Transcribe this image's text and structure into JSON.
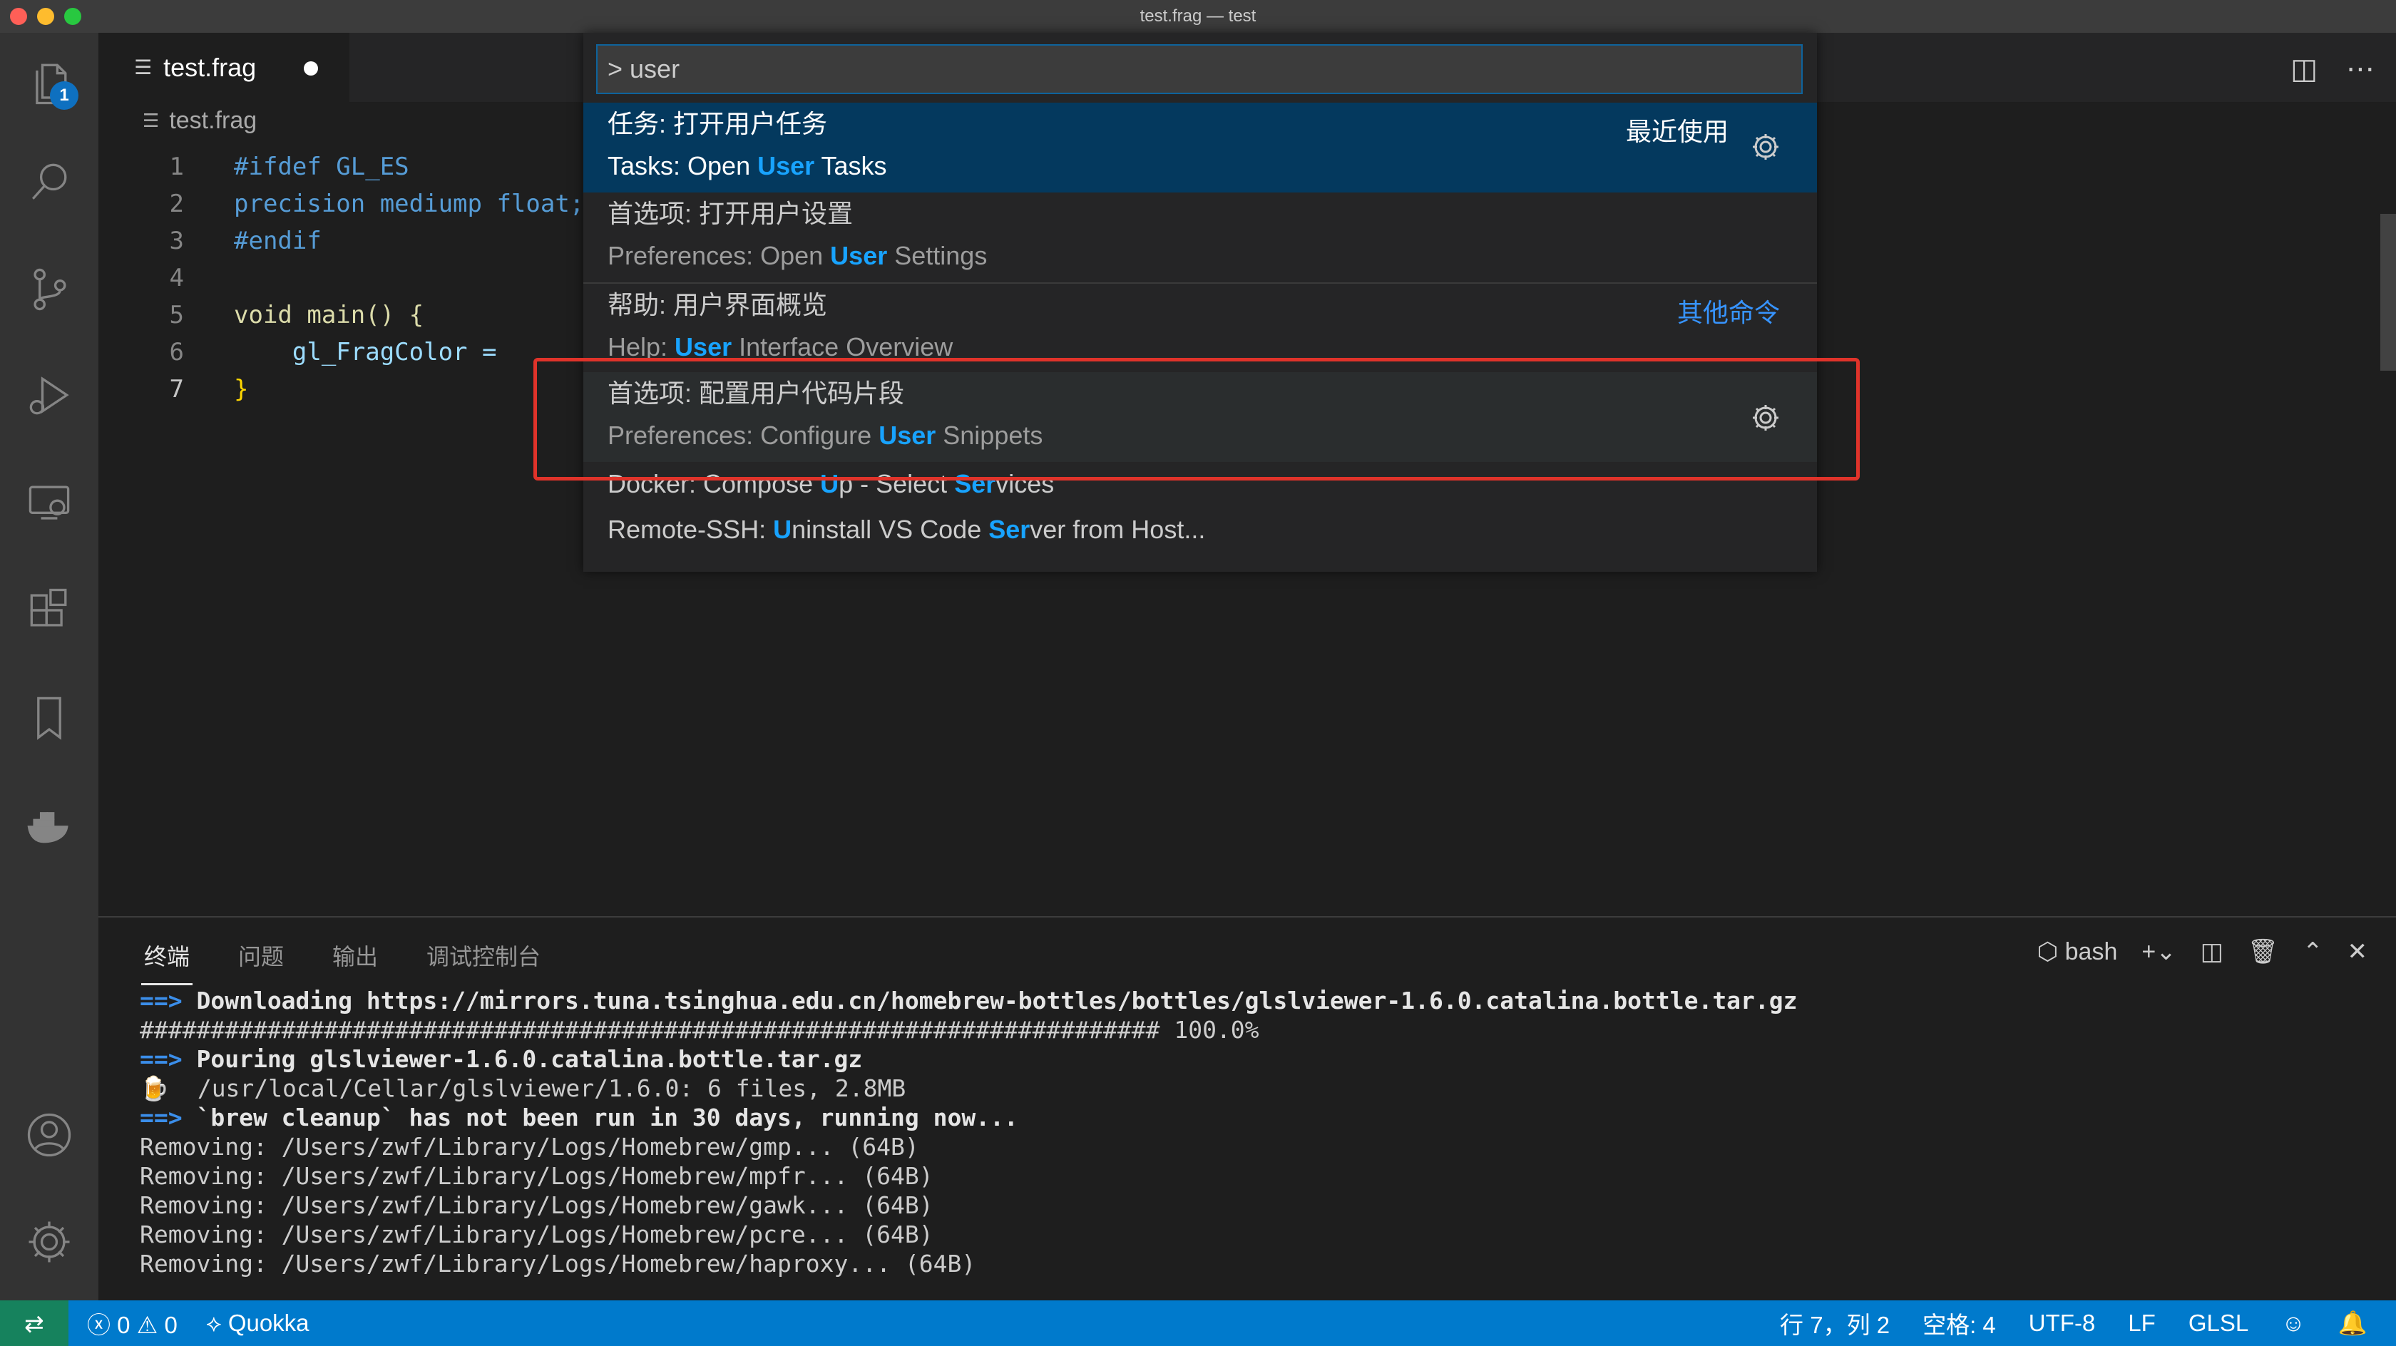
{
  "window": {
    "title": "test.frag — test"
  },
  "activity_bar": {
    "explorer_badge": "1"
  },
  "editor_tab": {
    "label": "test.frag",
    "icon": "lines-icon"
  },
  "breadcrumb": {
    "file": "test.frag"
  },
  "code_lines": [
    {
      "num": "1",
      "text": "#ifdef GL_ES"
    },
    {
      "num": "2",
      "text": "precision mediump float;"
    },
    {
      "num": "3",
      "text": "#endif"
    },
    {
      "num": "4",
      "text": ""
    },
    {
      "num": "5",
      "text": "void main() {"
    },
    {
      "num": "6",
      "text": "    gl_FragColor = "
    },
    {
      "num": "7",
      "text": "}"
    }
  ],
  "command_palette": {
    "input_value": "> user",
    "items": [
      {
        "main": "任务: 打开用户任务",
        "sub_pre": "Tasks: Open ",
        "sub_hl": "User",
        "sub_post": " Tasks",
        "right": "最近使用"
      },
      {
        "main": "首选项: 打开用户设置",
        "sub_pre": "Preferences: Open ",
        "sub_hl": "User",
        "sub_post": " Settings"
      },
      {
        "main": "帮助: 用户界面概览",
        "sub_pre": "Help: ",
        "sub_hl": "User",
        "sub_post": " Interface Overview",
        "right": "其他命令"
      },
      {
        "main": "首选项: 配置用户代码片段",
        "sub_pre": "Preferences: Configure ",
        "sub_hl": "User",
        "sub_post": " Snippets"
      }
    ],
    "docker": {
      "a": "Docker: Compose ",
      "b": "U",
      "c": "p - Select ",
      "d": "Ser",
      "e": "vices"
    },
    "remote": {
      "a": "Remote-SSH: ",
      "b": "U",
      "c": "ninstall VS Code ",
      "d": "Ser",
      "e": "ver from Host..."
    }
  },
  "panel": {
    "tabs": [
      "终端",
      "问题",
      "输出",
      "调试控制台"
    ],
    "shell": "bash"
  },
  "terminal_lines": {
    "l1_arrow": "==>",
    "l1": " Downloading https://mirrors.tuna.tsinghua.edu.cn/homebrew-bottles/bottles/glslviewer-1.6.0.catalina.bottle.tar.gz",
    "l2": "######################################################################## 100.0%",
    "l3_arrow": "==>",
    "l3": " Pouring glslviewer-1.6.0.catalina.bottle.tar.gz",
    "l4": "🍺  /usr/local/Cellar/glslviewer/1.6.0: 6 files, 2.8MB",
    "l5_arrow": "==>",
    "l5": " `brew cleanup` has not been run in 30 days, running now...",
    "l6": "Removing: /Users/zwf/Library/Logs/Homebrew/gmp... (64B)",
    "l7": "Removing: /Users/zwf/Library/Logs/Homebrew/mpfr... (64B)",
    "l8": "Removing: /Users/zwf/Library/Logs/Homebrew/gawk... (64B)",
    "l9": "Removing: /Users/zwf/Library/Logs/Homebrew/pcre... (64B)",
    "l10": "Removing: /Users/zwf/Library/Logs/Homebrew/haproxy... (64B)"
  },
  "status_bar": {
    "errors": "0",
    "warnings": "0",
    "quokka": "Quokka",
    "position": "行 7，列 2",
    "spaces": "空格: 4",
    "encoding": "UTF-8",
    "eol": "LF",
    "language": "GLSL"
  },
  "colors": {
    "accent": "#007acc",
    "selection": "#04395e",
    "highlight": "#18a3ff",
    "annotation": "#e0332a"
  }
}
